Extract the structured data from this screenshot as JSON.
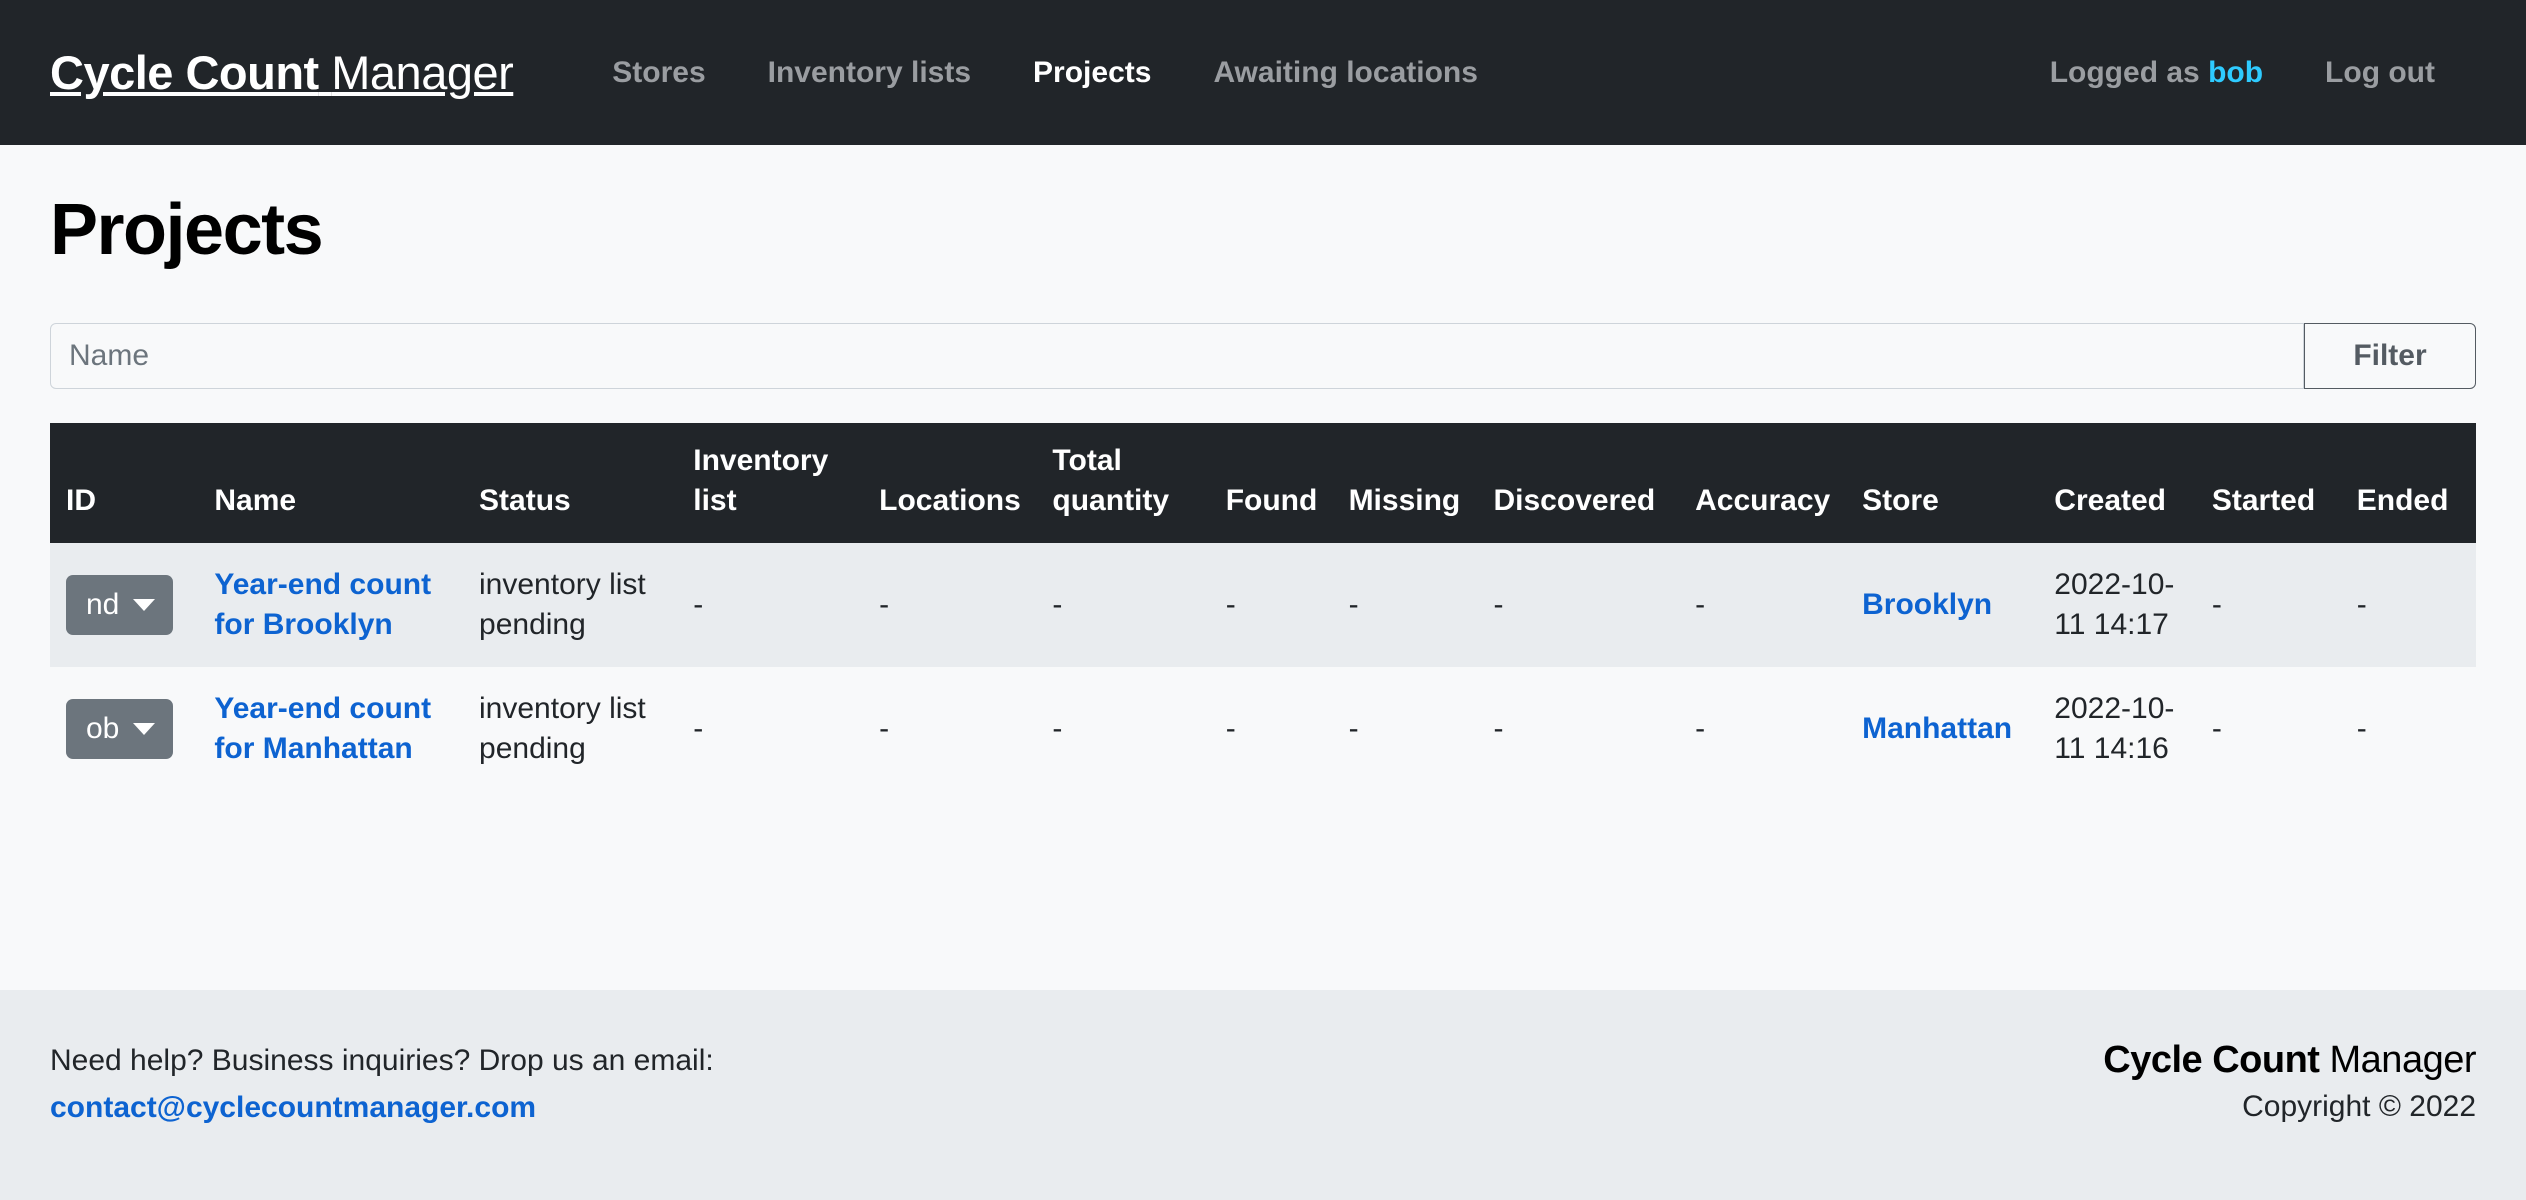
{
  "navbar": {
    "brand_bold": "Cycle Count",
    "brand_light": "Manager",
    "links": [
      {
        "label": "Stores",
        "active": false
      },
      {
        "label": "Inventory lists",
        "active": false
      },
      {
        "label": "Projects",
        "active": true
      },
      {
        "label": "Awaiting locations",
        "active": false
      }
    ],
    "logged_prefix": "Logged as",
    "username": "bob",
    "logout_label": "Log out",
    "accent_user_color": "#2ecbff"
  },
  "main": {
    "page_title": "Projects",
    "filter": {
      "placeholder": "Name",
      "value": "",
      "button_label": "Filter"
    },
    "table": {
      "headers": [
        "ID",
        "Name",
        "Status",
        "Inventory list",
        "Locations",
        "Total quantity",
        "Found",
        "Missing",
        "Discovered",
        "Accuracy",
        "Store",
        "Created",
        "Started",
        "Ended"
      ],
      "rows": [
        {
          "id_badge": "nd",
          "name": "Year-end count for Brooklyn",
          "status": "inventory list pending",
          "inventory_list": "-",
          "locations": "-",
          "total_quantity": "-",
          "found": "-",
          "missing": "-",
          "discovered": "-",
          "accuracy": "-",
          "store": "Brooklyn",
          "created": "2022-10-11 14:17",
          "started": "-",
          "ended": "-"
        },
        {
          "id_badge": "ob",
          "name": "Year-end count for Manhattan",
          "status": "inventory list pending",
          "inventory_list": "-",
          "locations": "-",
          "total_quantity": "-",
          "found": "-",
          "missing": "-",
          "discovered": "-",
          "accuracy": "-",
          "store": "Manhattan",
          "created": "2022-10-11 14:16",
          "started": "-",
          "ended": "-"
        }
      ]
    }
  },
  "footer": {
    "help_text": "Need help? Business inquiries? Drop us an email:",
    "email": "contact@cyclecountmanager.com",
    "brand_bold": "Cycle Count",
    "brand_light": "Manager",
    "copyright": "Copyright © 2022"
  },
  "colors": {
    "navbar_bg": "#212529",
    "page_bg": "#f8f9fa",
    "footer_bg": "#e9ecef",
    "link_blue": "#0d63d1",
    "muted_gray": "#6c757d",
    "row_stripe": "#e9ecef"
  }
}
